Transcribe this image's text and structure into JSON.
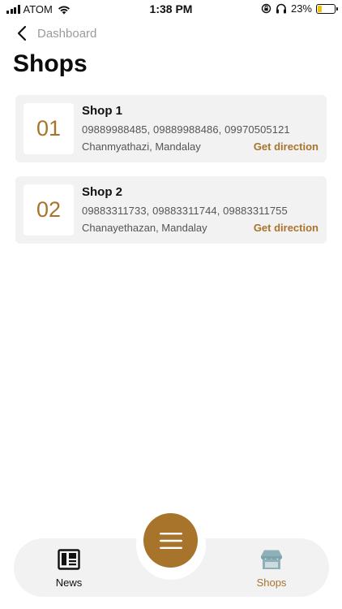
{
  "status_bar": {
    "carrier": "ATOM",
    "time": "1:38 PM",
    "battery": "23%",
    "battery_level": 0.23,
    "icons": [
      "signal-icon",
      "wifi-icon",
      "rotation-lock-icon",
      "headphones-icon",
      "battery-icon"
    ]
  },
  "nav": {
    "back_label": "Dashboard",
    "title": "Shops"
  },
  "shops": [
    {
      "number": "01",
      "name": "Shop 1",
      "phones": "09889988485, 09889988486, 09970505121",
      "address": "Chanmyathazi, Mandalay",
      "direction_label": "Get direction"
    },
    {
      "number": "02",
      "name": "Shop 2",
      "phones": "09883311733, 09883311744, 09883311755",
      "address": "Chanayethazan, Mandalay",
      "direction_label": "Get direction"
    }
  ],
  "bottom_nav": {
    "news_label": "News",
    "shops_label": "Shops",
    "menu_icon": "hamburger-menu-icon"
  },
  "colors": {
    "accent": "#a8742c",
    "card_bg": "#f2f2f2",
    "muted_text": "#9b9b9b",
    "shops_icon": "#8fb0b8"
  }
}
